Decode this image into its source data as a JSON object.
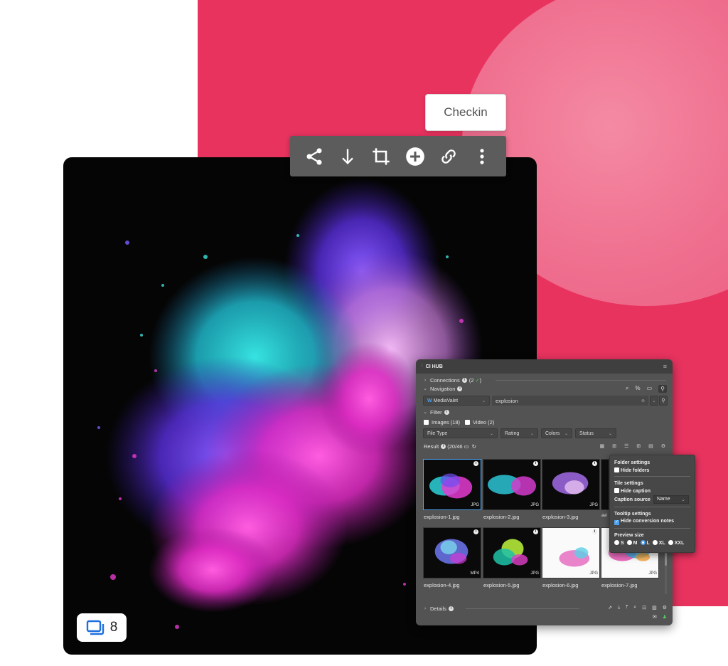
{
  "checkin_label": "Checkin",
  "toolbar": {
    "buttons": [
      "share-icon",
      "download-icon",
      "crop-icon",
      "add-icon",
      "link-icon",
      "more-icon"
    ]
  },
  "badge": {
    "count": "8"
  },
  "panel": {
    "tab_title": "CI HUB",
    "connections_label": "Connections",
    "connections_count": "(2",
    "navigation_label": "Navigation",
    "source_select": "MediaValet",
    "search_value": "explosion",
    "filter_label": "Filter",
    "images_label": "Images (18)",
    "video_label": "Video (2)",
    "filters": [
      "File Type",
      "Rating",
      "Colors",
      "Status"
    ],
    "result_label": "Result",
    "result_count": "(20/46",
    "tiles": [
      {
        "caption": "explosion-1.jpg",
        "type": "JPG"
      },
      {
        "caption": "explosion-2.jpg",
        "type": "JPG"
      },
      {
        "caption": "explosion-3.jpg",
        "type": "JPG"
      },
      {
        "caption": "avi",
        "type": ""
      },
      {
        "caption": "explosion-4.jpg",
        "type": "MP4"
      },
      {
        "caption": "explosion-5.jpg",
        "type": "JPG"
      },
      {
        "caption": "explosion-6.jpg",
        "type": "JPG"
      },
      {
        "caption": "explosion-7.jpg",
        "type": "JPG"
      }
    ],
    "details_label": "Details"
  },
  "popup": {
    "folder_settings": "Folder settings",
    "hide_folders": "Hide folders",
    "tile_settings": "Tile settings",
    "hide_caption": "Hide caption",
    "caption_source": "Caption source",
    "caption_source_value": "Name",
    "tooltip_settings": "Tooltip settings",
    "hide_conversion_notes": "Hide conversion notes",
    "preview_size": "Preview size",
    "sizes": [
      "S",
      "M",
      "L",
      "XL",
      "XXL"
    ],
    "selected_size": "L"
  },
  "colors": {
    "background_pink": "#e8335f",
    "panel_bg": "#535353",
    "accent_blue": "#4ea3f1"
  }
}
